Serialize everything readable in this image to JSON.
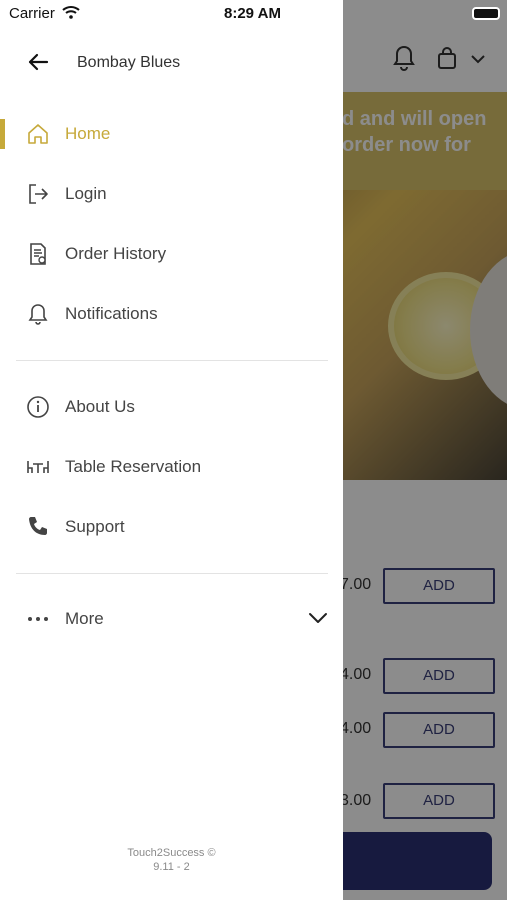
{
  "status_bar": {
    "carrier": "Carrier",
    "time": "8:29 AM"
  },
  "drawer": {
    "title": "Bombay Blues",
    "items": [
      {
        "label": "Home",
        "icon": "home-icon",
        "active": true
      },
      {
        "label": "Login",
        "icon": "login-icon"
      },
      {
        "label": "Order History",
        "icon": "order-history-icon"
      },
      {
        "label": "Notifications",
        "icon": "bell-icon"
      },
      {
        "label": "About Us",
        "icon": "info-icon"
      },
      {
        "label": "Table Reservation",
        "icon": "table-icon"
      },
      {
        "label": "Support",
        "icon": "phone-icon"
      },
      {
        "label": "More",
        "icon": "more-dots-icon"
      }
    ],
    "footer": {
      "line1": "Touch2Success ©",
      "line2": "9.11 - 2"
    },
    "accent_color": "#c6a93a"
  },
  "background": {
    "banner_line1": "d and will open",
    "banner_line2": "order now for",
    "prices": [
      "7.00",
      "4.00",
      "4.00",
      "3.00"
    ],
    "add_label": "ADD"
  }
}
